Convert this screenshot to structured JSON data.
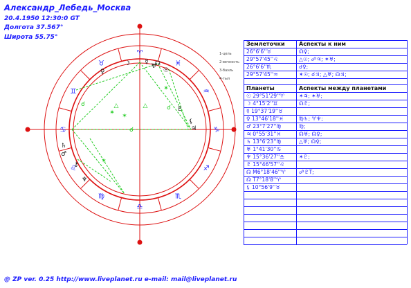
{
  "header": {
    "title": "Александр_Лебедь_Москва",
    "datetime": "20.4.1950 12:30:0 GT",
    "longitude": "Долгота 37.567°",
    "latitude": "Широта 55.75°"
  },
  "footer": "@ ZP  ver. 0.25 http://www.liveplanet.ru  e-mail: mail@liveplanet.ru",
  "colors": {
    "blue": "#1a1aff",
    "red": "#dd1111",
    "green": "#22cc22"
  },
  "wheel": {
    "signs": [
      "♈",
      "♉",
      "♊",
      "♋",
      "♌",
      "♍",
      "♎",
      "♏",
      "♐",
      "♑",
      "♒",
      "♓"
    ],
    "planet_glyphs": [
      "☉",
      "☽",
      "☿",
      "♀",
      "♂",
      "♃",
      "♄",
      "♅",
      "♆",
      "♇",
      "☊",
      "⚸",
      "⚷"
    ],
    "aspect_glyphs": [
      "△",
      "△",
      "☌",
      "☌",
      "☌",
      "✶",
      "✶",
      "✶",
      "✶"
    ]
  },
  "side_labels": [
    "1-цель",
    "2-вечность",
    "3-баэль",
    "4-тыл"
  ],
  "points_table": {
    "col1_header": "Землеточки",
    "col2_header": "Аспекты к ним",
    "rows": [
      {
        "pos": "26°6'6''♉",
        "aspects": "☊♀;"
      },
      {
        "pos": "29°57'45''♌",
        "aspects": "△☉; ☍♃; ✶♅;"
      },
      {
        "pos": "26°6'6''♏",
        "aspects": "☌♀;"
      },
      {
        "pos": "29°57'45''♒",
        "aspects": "✶☉; ☌♃; △♅; ☊♃;"
      }
    ]
  },
  "planets_table": {
    "col1_header": "Планеты",
    "col2_header": "Аспекты между планетами",
    "rows": [
      {
        "pos": "☉ 29°51'29''♈",
        "aspects": "✶♃; ✶♅;"
      },
      {
        "pos": "☽ 4°15'2''♊",
        "aspects": "☊♇;"
      },
      {
        "pos": "☿ 19°37'19''♉",
        "aspects": ""
      },
      {
        "pos": "♀ 13°46'18''♓",
        "aspects": "♍♄; ♈♆;"
      },
      {
        "pos": "♂ 23°7'27''♍",
        "aspects": "♍;"
      },
      {
        "pos": "♃ 0°55'31''♓",
        "aspects": "☊♅; ☊♀;"
      },
      {
        "pos": "♄ 13°6'23''♍",
        "aspects": "△♅; ☊♀;"
      },
      {
        "pos": "♅ 1°41'30''♋",
        "aspects": ""
      },
      {
        "pos": "♆ 15°36'27''♎",
        "aspects": "✶♇;"
      },
      {
        "pos": "♇ 15°46'57''♌",
        "aspects": ""
      },
      {
        "pos": "☊ M6°18'46''♈",
        "aspects": "☍♇T;"
      },
      {
        "pos": "☊ T7°18'8''♈",
        "aspects": ""
      },
      {
        "pos": "⚸ 10°56'9''♉",
        "aspects": ""
      }
    ]
  }
}
